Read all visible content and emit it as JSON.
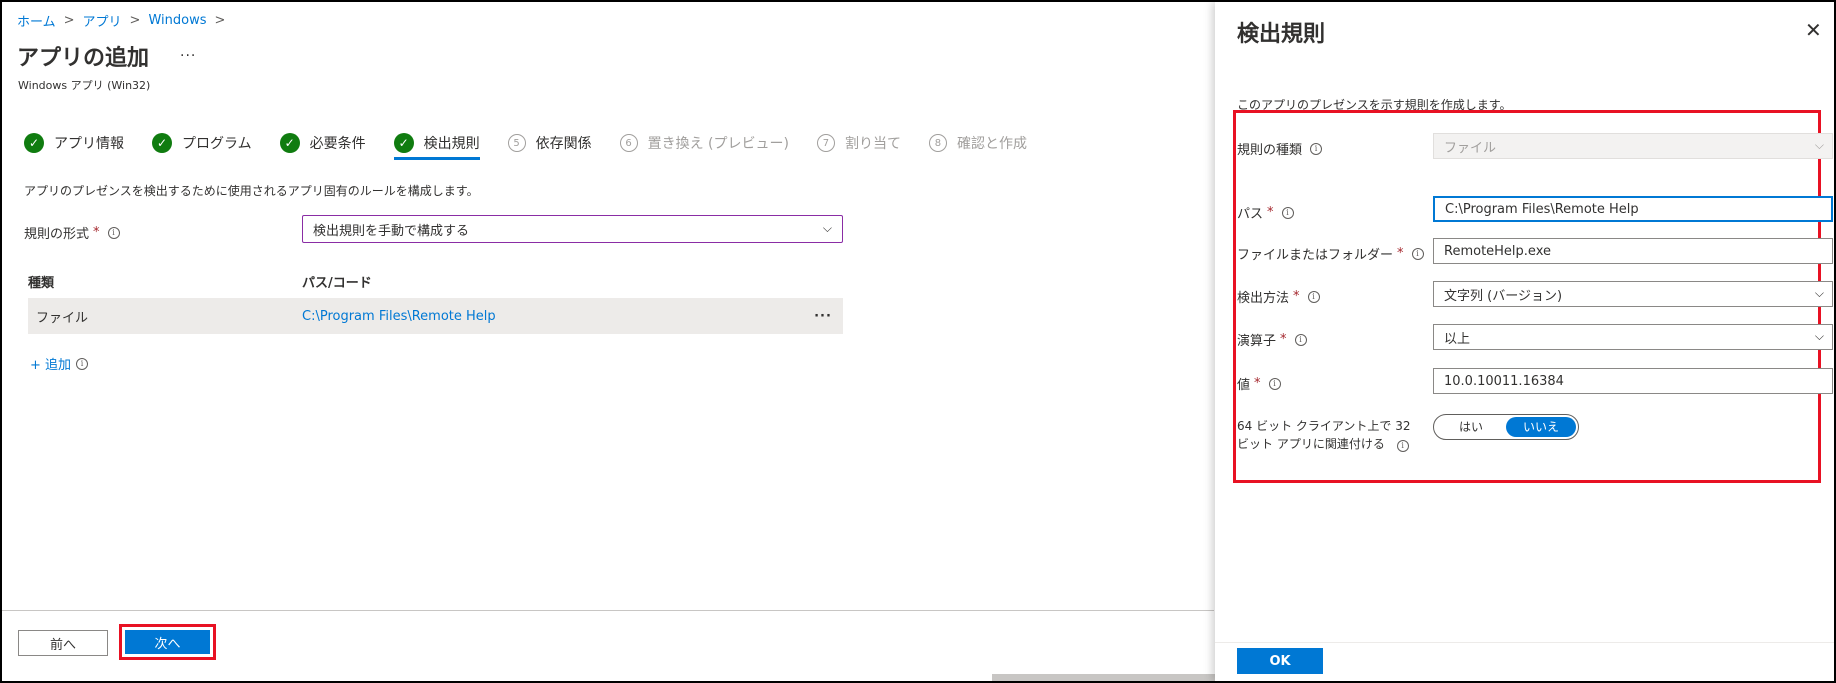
{
  "breadcrumb": {
    "home": "ホーム",
    "apps": "アプリ",
    "windows": "Windows",
    "sep": ">"
  },
  "page": {
    "title": "アプリの追加",
    "more": "···",
    "subtitle": "Windows アプリ (Win32)"
  },
  "steps": [
    {
      "label": "アプリ情報",
      "state": "done"
    },
    {
      "label": "プログラム",
      "state": "done"
    },
    {
      "label": "必要条件",
      "state": "done"
    },
    {
      "label": "検出規則",
      "state": "active"
    },
    {
      "label": "依存関係",
      "state": "pending",
      "num": "5"
    },
    {
      "label": "置き換え (プレビュー)",
      "state": "disabled",
      "num": "6"
    },
    {
      "label": "割り当て",
      "state": "disabled",
      "num": "7"
    },
    {
      "label": "確認と作成",
      "state": "disabled",
      "num": "8"
    }
  ],
  "main": {
    "description": "アプリのプレゼンスを検出するために使用されるアプリ固有のルールを構成します。",
    "rule_format_label": "規則の形式",
    "rule_format_value": "検出規則を手動で構成する",
    "table": {
      "col_type": "種類",
      "col_path": "パス/コード",
      "row": {
        "type": "ファイル",
        "path": "C:\\Program Files\\Remote Help",
        "more": "···"
      }
    },
    "add_link": "+ 追加"
  },
  "footer": {
    "prev": "前へ",
    "next": "次へ"
  },
  "panel": {
    "title": "検出規則",
    "close": "✕",
    "description": "このアプリのプレゼンスを示す規則を作成します。",
    "fields": {
      "rule_type": {
        "label": "規則の種類",
        "value": "ファイル"
      },
      "path": {
        "label": "パス",
        "value": "C:\\Program Files\\Remote Help"
      },
      "file_or_folder": {
        "label": "ファイルまたはフォルダー",
        "value": "RemoteHelp.exe"
      },
      "detection_method": {
        "label": "検出方法",
        "value": "文字列 (バージョン)"
      },
      "operator": {
        "label": "演算子",
        "value": "以上"
      },
      "value": {
        "label": "値",
        "value": "10.0.10011.16384"
      },
      "assoc_32bit": {
        "label": "64 ビット クライアント上で 32 ビット アプリに関連付ける",
        "yes": "はい",
        "no": "いいえ",
        "selected": "no"
      }
    },
    "ok": "OK"
  },
  "colors": {
    "accent": "#0078d4",
    "success": "#107c10",
    "highlight": "#e81123"
  }
}
